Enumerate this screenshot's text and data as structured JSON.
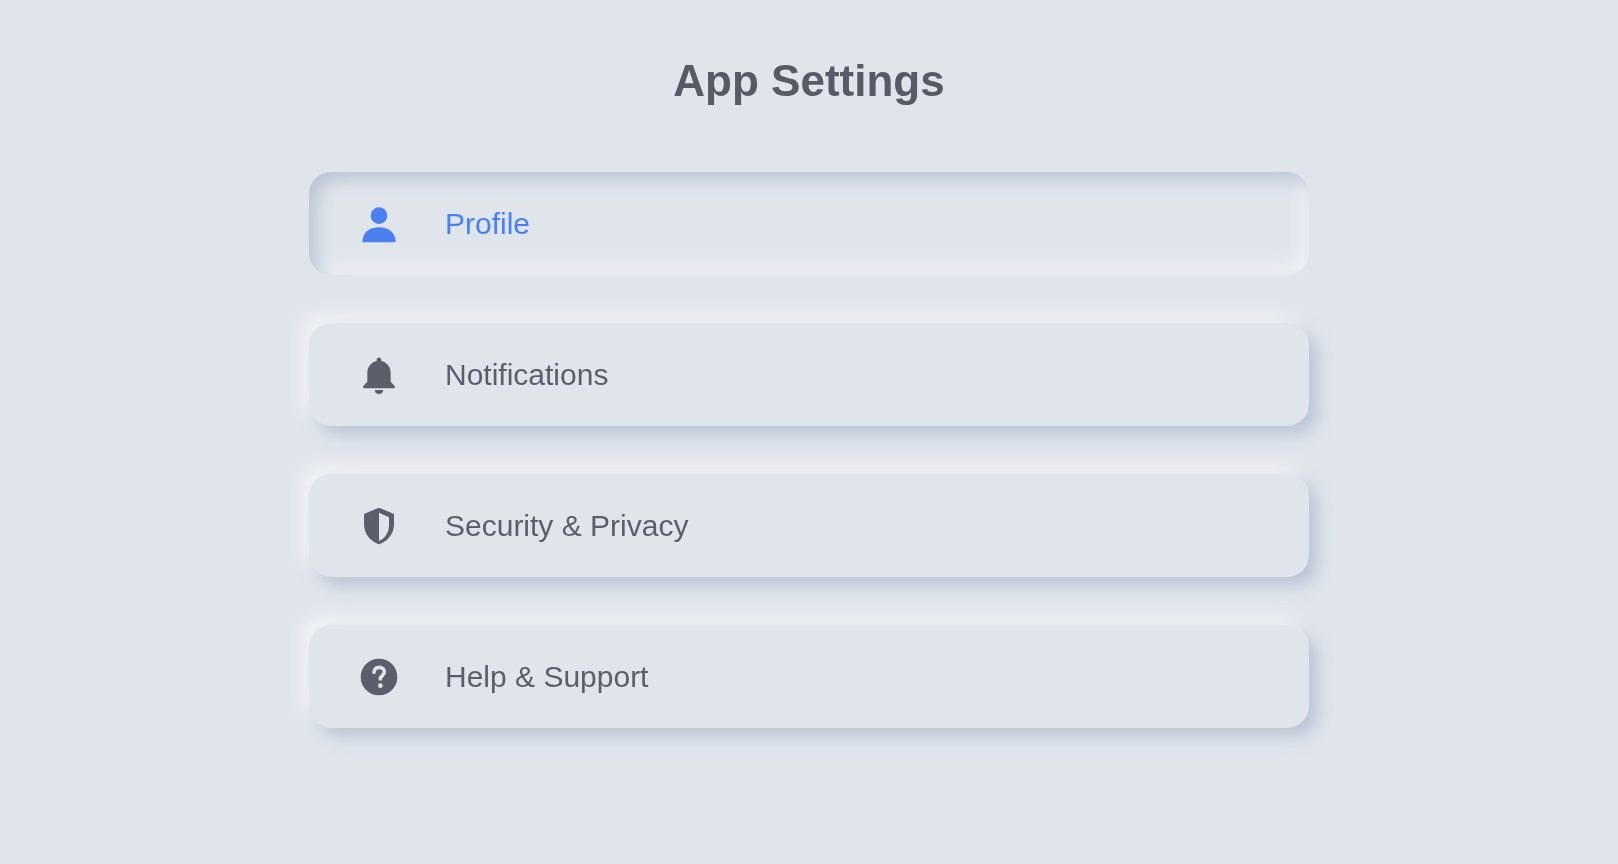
{
  "title": "App Settings",
  "items": [
    {
      "label": "Profile",
      "selected": true
    },
    {
      "label": "Notifications",
      "selected": false
    },
    {
      "label": "Security & Privacy",
      "selected": false
    },
    {
      "label": "Help & Support",
      "selected": false
    }
  ]
}
